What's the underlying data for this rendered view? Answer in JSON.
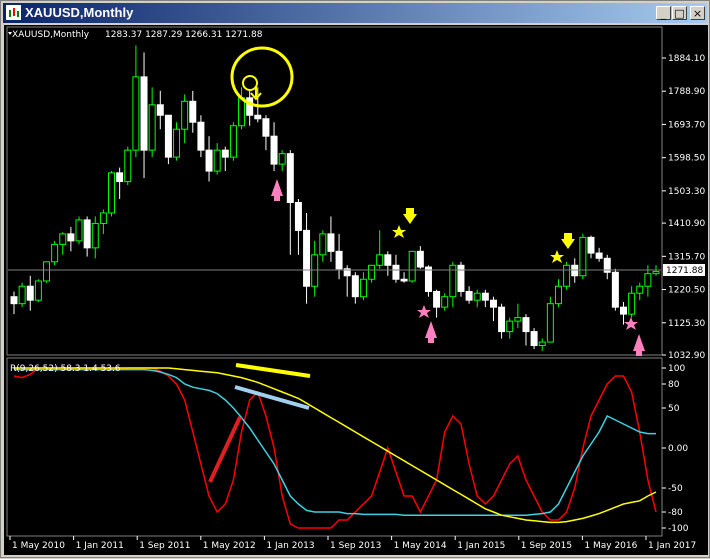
{
  "window": {
    "title": "XAUUSD,Monthly",
    "buttons": {
      "minimize": "_",
      "maximize": "□",
      "close": "×"
    }
  },
  "main_panel": {
    "symbol_label": "XAUUSD,Monthly",
    "ohlc": "1283.37 1287.29 1266.31 1271.88",
    "current_price": "1271.88",
    "price_ticks": [
      "1884.10",
      "1788.90",
      "1693.70",
      "1598.50",
      "1503.30",
      "1410.90",
      "1315.70",
      "1220.50",
      "1125.30",
      "1032.90"
    ]
  },
  "indicator_panel": {
    "label": "R(9,26,52) 58.3 1.4 53.6",
    "ticks": [
      "100",
      "80",
      "50",
      "0.00",
      "-50",
      "-80",
      "-100"
    ]
  },
  "time_axis": {
    "labels": [
      "1 May 2010",
      "1 Jan 2011",
      "1 Sep 2011",
      "1 May 2012",
      "1 Jan 2013",
      "1 Sep 2013",
      "1 May 2014",
      "1 Jan 2015",
      "1 Sep 2015",
      "1 May 2016",
      "1 Jan 2017"
    ]
  },
  "colors": {
    "bull": "#00ff00",
    "bear": "#ffffff",
    "red_line": "#ff0000",
    "cyan_line": "#40d0e0",
    "yellow_line": "#ffff00",
    "annotation_yellow": "#ffff00",
    "annotation_pink": "#ff80c0"
  },
  "chart_data": {
    "type": "candlestick",
    "title": "XAUUSD,Monthly",
    "ylim": [
      1032.9,
      1884.1
    ],
    "candles": [
      [
        1200,
        1215,
        1150,
        1180
      ],
      [
        1180,
        1240,
        1170,
        1230
      ],
      [
        1230,
        1260,
        1160,
        1190
      ],
      [
        1190,
        1250,
        1185,
        1245
      ],
      [
        1245,
        1300,
        1240,
        1300
      ],
      [
        1300,
        1360,
        1290,
        1350
      ],
      [
        1350,
        1385,
        1320,
        1380
      ],
      [
        1380,
        1400,
        1330,
        1360
      ],
      [
        1360,
        1430,
        1350,
        1420
      ],
      [
        1420,
        1430,
        1315,
        1340
      ],
      [
        1340,
        1430,
        1310,
        1410
      ],
      [
        1410,
        1450,
        1380,
        1440
      ],
      [
        1440,
        1560,
        1430,
        1555
      ],
      [
        1555,
        1570,
        1480,
        1530
      ],
      [
        1530,
        1630,
        1520,
        1620
      ],
      [
        1620,
        1920,
        1600,
        1830
      ],
      [
        1830,
        1900,
        1540,
        1620
      ],
      [
        1620,
        1800,
        1600,
        1750
      ],
      [
        1750,
        1790,
        1680,
        1720
      ],
      [
        1720,
        1700,
        1580,
        1600
      ],
      [
        1600,
        1700,
        1590,
        1680
      ],
      [
        1680,
        1780,
        1640,
        1760
      ],
      [
        1760,
        1790,
        1670,
        1700
      ],
      [
        1700,
        1720,
        1600,
        1620
      ],
      [
        1620,
        1660,
        1530,
        1560
      ],
      [
        1560,
        1640,
        1550,
        1620
      ],
      [
        1620,
        1630,
        1560,
        1600
      ],
      [
        1600,
        1700,
        1590,
        1690
      ],
      [
        1690,
        1800,
        1680,
        1770
      ],
      [
        1770,
        1790,
        1690,
        1720
      ],
      [
        1720,
        1800,
        1700,
        1710
      ],
      [
        1710,
        1720,
        1620,
        1660
      ],
      [
        1660,
        1700,
        1560,
        1580
      ],
      [
        1580,
        1620,
        1560,
        1610
      ],
      [
        1610,
        1620,
        1320,
        1470
      ],
      [
        1470,
        1480,
        1320,
        1390
      ],
      [
        1390,
        1440,
        1180,
        1230
      ],
      [
        1230,
        1360,
        1200,
        1320
      ],
      [
        1320,
        1390,
        1300,
        1380
      ],
      [
        1380,
        1430,
        1300,
        1330
      ],
      [
        1330,
        1380,
        1250,
        1280
      ],
      [
        1280,
        1290,
        1200,
        1260
      ],
      [
        1260,
        1270,
        1180,
        1200
      ],
      [
        1200,
        1270,
        1190,
        1250
      ],
      [
        1250,
        1290,
        1240,
        1290
      ],
      [
        1290,
        1390,
        1280,
        1320
      ],
      [
        1320,
        1330,
        1260,
        1290
      ],
      [
        1290,
        1320,
        1240,
        1250
      ],
      [
        1250,
        1270,
        1240,
        1245
      ],
      [
        1245,
        1330,
        1240,
        1330
      ],
      [
        1330,
        1345,
        1280,
        1285
      ],
      [
        1285,
        1290,
        1200,
        1215
      ],
      [
        1215,
        1220,
        1140,
        1170
      ],
      [
        1170,
        1210,
        1160,
        1200
      ],
      [
        1200,
        1300,
        1170,
        1290
      ],
      [
        1290,
        1300,
        1200,
        1215
      ],
      [
        1215,
        1230,
        1180,
        1190
      ],
      [
        1190,
        1220,
        1170,
        1210
      ],
      [
        1210,
        1220,
        1170,
        1190
      ],
      [
        1190,
        1200,
        1130,
        1170
      ],
      [
        1170,
        1180,
        1080,
        1100
      ],
      [
        1100,
        1140,
        1080,
        1130
      ],
      [
        1130,
        1180,
        1110,
        1140
      ],
      [
        1140,
        1150,
        1060,
        1100
      ],
      [
        1100,
        1110,
        1050,
        1060
      ],
      [
        1060,
        1080,
        1045,
        1070
      ],
      [
        1070,
        1200,
        1070,
        1180
      ],
      [
        1180,
        1250,
        1170,
        1230
      ],
      [
        1230,
        1300,
        1220,
        1290
      ],
      [
        1290,
        1310,
        1240,
        1260
      ],
      [
        1260,
        1380,
        1250,
        1370
      ],
      [
        1370,
        1375,
        1310,
        1325
      ],
      [
        1325,
        1340,
        1300,
        1310
      ],
      [
        1310,
        1320,
        1250,
        1270
      ],
      [
        1270,
        1280,
        1160,
        1170
      ],
      [
        1170,
        1185,
        1120,
        1150
      ],
      [
        1150,
        1230,
        1140,
        1210
      ],
      [
        1210,
        1240,
        1190,
        1230
      ],
      [
        1230,
        1290,
        1200,
        1266
      ],
      [
        1266,
        1290,
        1260,
        1272
      ]
    ],
    "indicator": {
      "label": "R(9,26,52)",
      "values_last": [
        58.3,
        1.4,
        53.6
      ],
      "ylim": [
        -100,
        100
      ],
      "red": [
        90,
        88,
        92,
        100,
        100,
        100,
        100,
        100,
        100,
        100,
        100,
        100,
        98,
        98,
        100,
        100,
        100,
        100,
        96,
        90,
        80,
        60,
        20,
        -20,
        -60,
        -80,
        -70,
        -40,
        20,
        60,
        70,
        40,
        0,
        -60,
        -95,
        -100,
        -100,
        -100,
        -100,
        -100,
        -90,
        -90,
        -80,
        -70,
        -60,
        -30,
        0,
        -30,
        -60,
        -60,
        -80,
        -60,
        -40,
        20,
        40,
        30,
        -20,
        -60,
        -70,
        -60,
        -40,
        -20,
        -10,
        -40,
        -60,
        -80,
        -90,
        -90,
        -80,
        -50,
        0,
        40,
        60,
        80,
        90,
        90,
        70,
        20,
        -40,
        -80
      ],
      "cyan": [
        98,
        98,
        98,
        98,
        98,
        98,
        98,
        98,
        98,
        98,
        98,
        98,
        98,
        98,
        98,
        98,
        98,
        97,
        95,
        92,
        88,
        80,
        76,
        74,
        72,
        68,
        60,
        50,
        38,
        25,
        10,
        -5,
        -20,
        -40,
        -60,
        -70,
        -78,
        -80,
        -80,
        -80,
        -80,
        -82,
        -82,
        -83,
        -83,
        -83,
        -83,
        -83,
        -84,
        -84,
        -84,
        -84,
        -84,
        -84,
        -84,
        -84,
        -84,
        -84,
        -84,
        -84,
        -84,
        -84,
        -84,
        -84,
        -83,
        -82,
        -80,
        -70,
        -50,
        -30,
        -10,
        5,
        20,
        40,
        35,
        30,
        25,
        20,
        18,
        18
      ],
      "yellow": [
        100,
        100,
        100,
        100,
        100,
        100,
        100,
        100,
        100,
        100,
        100,
        100,
        100,
        100,
        100,
        100,
        100,
        100,
        100,
        100,
        99,
        98,
        97,
        96,
        95,
        94,
        92,
        90,
        88,
        85,
        82,
        78,
        74,
        70,
        66,
        62,
        56,
        50,
        44,
        38,
        32,
        26,
        20,
        14,
        8,
        2,
        -4,
        -10,
        -16,
        -22,
        -28,
        -34,
        -40,
        -46,
        -52,
        -58,
        -64,
        -70,
        -76,
        -80,
        -84,
        -86,
        -88,
        -90,
        -91,
        -92,
        -93,
        -93,
        -92,
        -90,
        -88,
        -85,
        -82,
        -78,
        -74,
        -70,
        -68,
        -66,
        -60,
        -55
      ]
    }
  }
}
